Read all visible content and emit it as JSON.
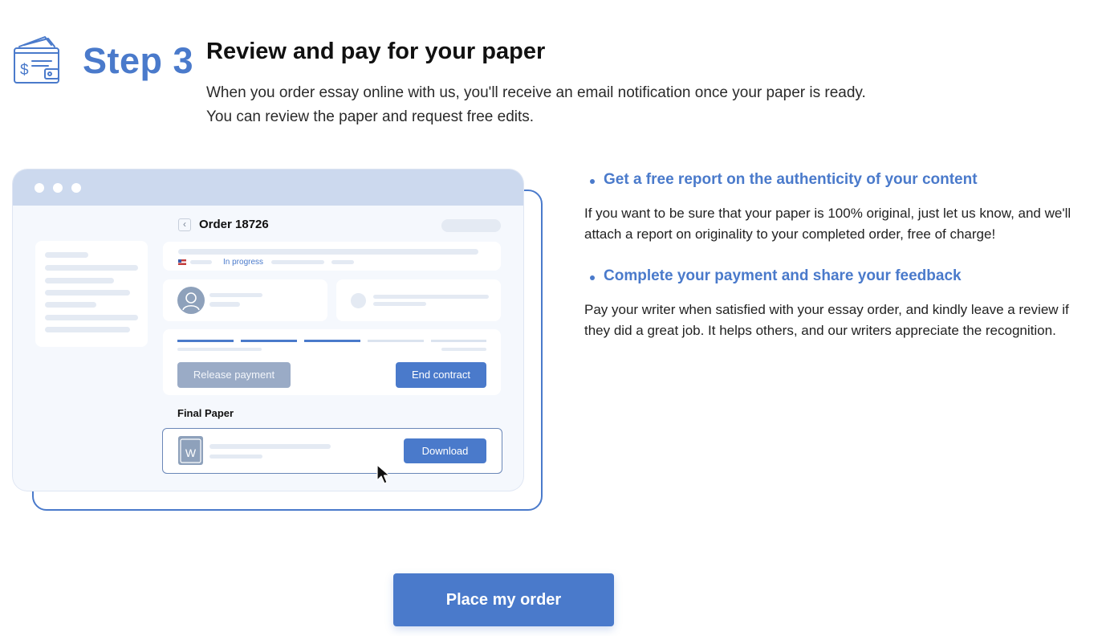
{
  "header": {
    "icon": "wallet-icon",
    "step_label": "Step 3",
    "title": "Review and pay for your paper",
    "description": "When you order essay online with us, you'll receive an email notification once your paper is ready. You can review the paper and request free edits."
  },
  "mockup": {
    "order_title": "Order 18726",
    "status": "In progress",
    "release_button": "Release payment",
    "end_button": "End contract",
    "final_paper_label": "Final Paper",
    "file_icon_letter": "W",
    "download_button": "Download"
  },
  "features": [
    {
      "title": "Get a free report on the authenticity of your content",
      "body": "If you want to be sure that your paper is 100% original, just let us know, and we'll attach a report on originality to your completed order, free of charge!"
    },
    {
      "title": "Complete your payment and share your feedback",
      "body": "Pay your writer when satisfied with your essay order, and kindly leave a review if they did a great job. It helps others, and our writers appreciate the recognition."
    }
  ],
  "cta": {
    "label": "Place my order"
  },
  "colors": {
    "accent": "#4a7acb",
    "muted_button": "#9aabc6",
    "window_bar": "#ccd9ee"
  }
}
